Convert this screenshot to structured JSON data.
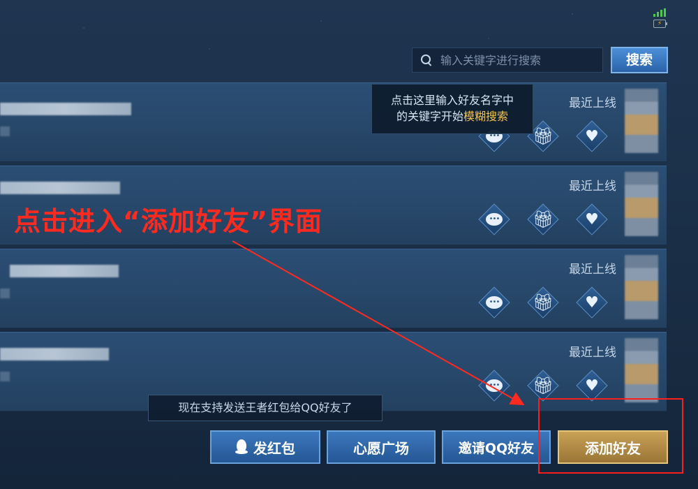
{
  "search": {
    "placeholder": "输入关键字进行搜索",
    "button_label": "搜索"
  },
  "tooltip": {
    "line1": "点击这里输入好友名字中",
    "line2_prefix": "的关键字开始",
    "line2_highlight": "模糊搜索"
  },
  "friends": [
    {
      "status": "最近上线"
    },
    {
      "status": "最近上线"
    },
    {
      "status": "最近上线"
    },
    {
      "status": "最近上线"
    }
  ],
  "annotation": {
    "text": "点击进入“添加好友”界面",
    "color": "#ff2a1f"
  },
  "notice": {
    "text": "现在支持发送王者红包给QQ好友了"
  },
  "bottom_buttons": {
    "red_packet": "发红包",
    "wish_square": "心愿广场",
    "invite_qq": "邀请QQ好友",
    "add_friend": "添加好友"
  },
  "colors": {
    "accent_blue": "#2b63a8",
    "gold": "#c9a257",
    "highlight_red": "#ff1e1e",
    "tooltip_highlight": "#f3c44a"
  },
  "icons": [
    "search-icon",
    "chat-icon",
    "gift-icon",
    "heart-icon",
    "qq-icon",
    "signal-icon",
    "battery-icon"
  ]
}
